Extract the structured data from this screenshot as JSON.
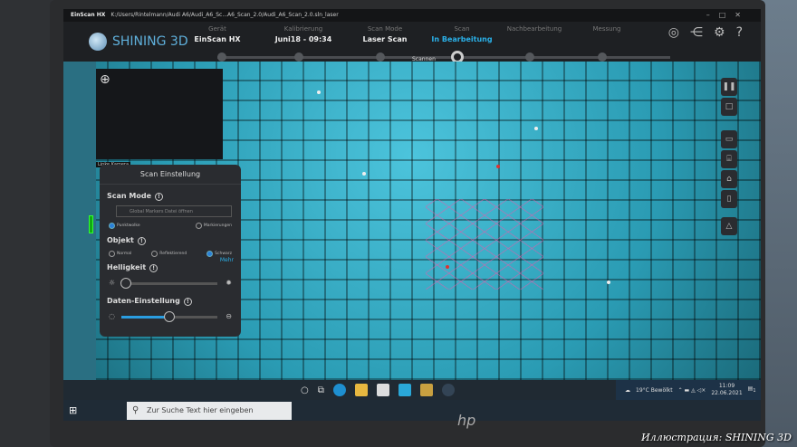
{
  "window": {
    "app": "EinScan HX",
    "path": "K:/Users/Rintelmann/Audi A6/Audi_A6_Sc...A6_Scan_2.0/Audi_A6_Scan_2.0.sln_laser"
  },
  "brand": {
    "logo_text": "SHINING 3D"
  },
  "steps": [
    {
      "key": "Gerät",
      "value": "EinScan HX"
    },
    {
      "key": "Kalibrierung",
      "value": "Juni18 - 09:34"
    },
    {
      "key": "Scan Mode",
      "value": "Laser Scan"
    },
    {
      "key": "Scan",
      "value": "In Bearbeitung"
    },
    {
      "key": "Nachbearbeitung",
      "value": ""
    },
    {
      "key": "Messung",
      "value": ""
    }
  ],
  "scan_label": "Scannen",
  "preview": {
    "camera_label": "Linke Kamera"
  },
  "panel": {
    "title": "Scan Einstellung",
    "scan_mode_label": "Scan Mode",
    "file_button": "Global Markers Datei öffnen",
    "scan_mode_options": [
      "Punktwolke",
      "Markierungen"
    ],
    "objekt_label": "Objekt",
    "objekt_options": [
      "Normal",
      "Reflektierend",
      "Schwarz"
    ],
    "mehr": "Mehr",
    "helligkeit_label": "Helligkeit",
    "helligkeit_value": 0.05,
    "daten_label": "Daten-Einstellung",
    "daten_value": 0.5
  },
  "taskbar": {
    "search_placeholder": "Zur Suche Text hier eingeben",
    "weather": "19°C  Bewölkt",
    "time": "11:09",
    "date": "22.06.2021",
    "notifications": "1"
  },
  "credit": "Иллюстрация: SHINING 3D",
  "colors": {
    "accent": "#2ab0e8",
    "scan": "#3bb4cc"
  }
}
